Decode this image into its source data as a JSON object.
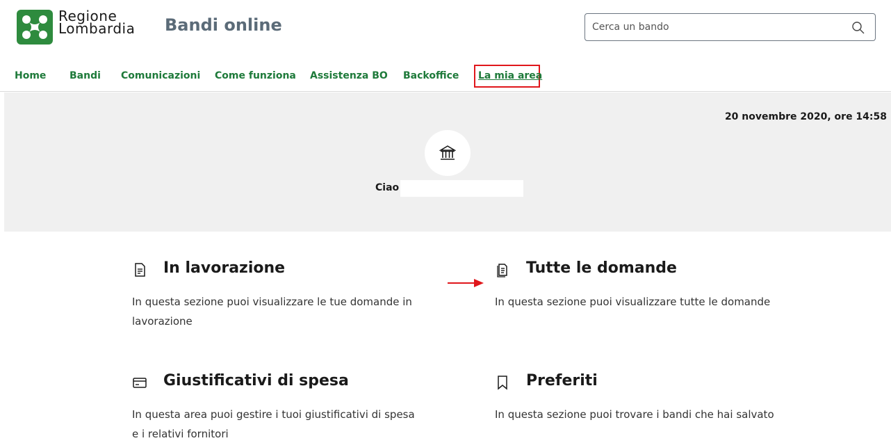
{
  "header": {
    "brand_line1": "Regione",
    "brand_line2": "Lombardia",
    "site_title": "Bandi online",
    "search_placeholder": "Cerca un bando",
    "search_icon": "search-icon",
    "logo_color": "#2e8b3e"
  },
  "nav": {
    "items": [
      {
        "label": "Home"
      },
      {
        "label": "Bandi"
      },
      {
        "label": "Comunicazioni"
      },
      {
        "label": "Come funziona"
      },
      {
        "label": "Assistenza BO"
      },
      {
        "label": "Backoffice"
      },
      {
        "label": "La mia area",
        "active": true
      }
    ],
    "accent_color": "#1e7a3a",
    "highlight_color": "#e0161b"
  },
  "banner": {
    "timestamp": "20 novembre 2020, ore 14:58",
    "avatar_icon": "institution-icon",
    "greeting": "Ciao"
  },
  "cards": [
    {
      "icon": "document-icon",
      "title": "In lavorazione",
      "description": "In questa sezione puoi visualizzare le tue domande in lavorazione"
    },
    {
      "icon": "documents-icon",
      "title": "Tutte le domande",
      "description": "In questa sezione puoi visualizzare tutte le domande"
    },
    {
      "icon": "credit-card-icon",
      "title": "Giustificativi di spesa",
      "description": "In questa area puoi gestire i tuoi giustificativi di spesa e i relativi fornitori"
    },
    {
      "icon": "bookmark-icon",
      "title": "Preferiti",
      "description": "In questa sezione puoi trovare i bandi che hai salvato"
    }
  ]
}
